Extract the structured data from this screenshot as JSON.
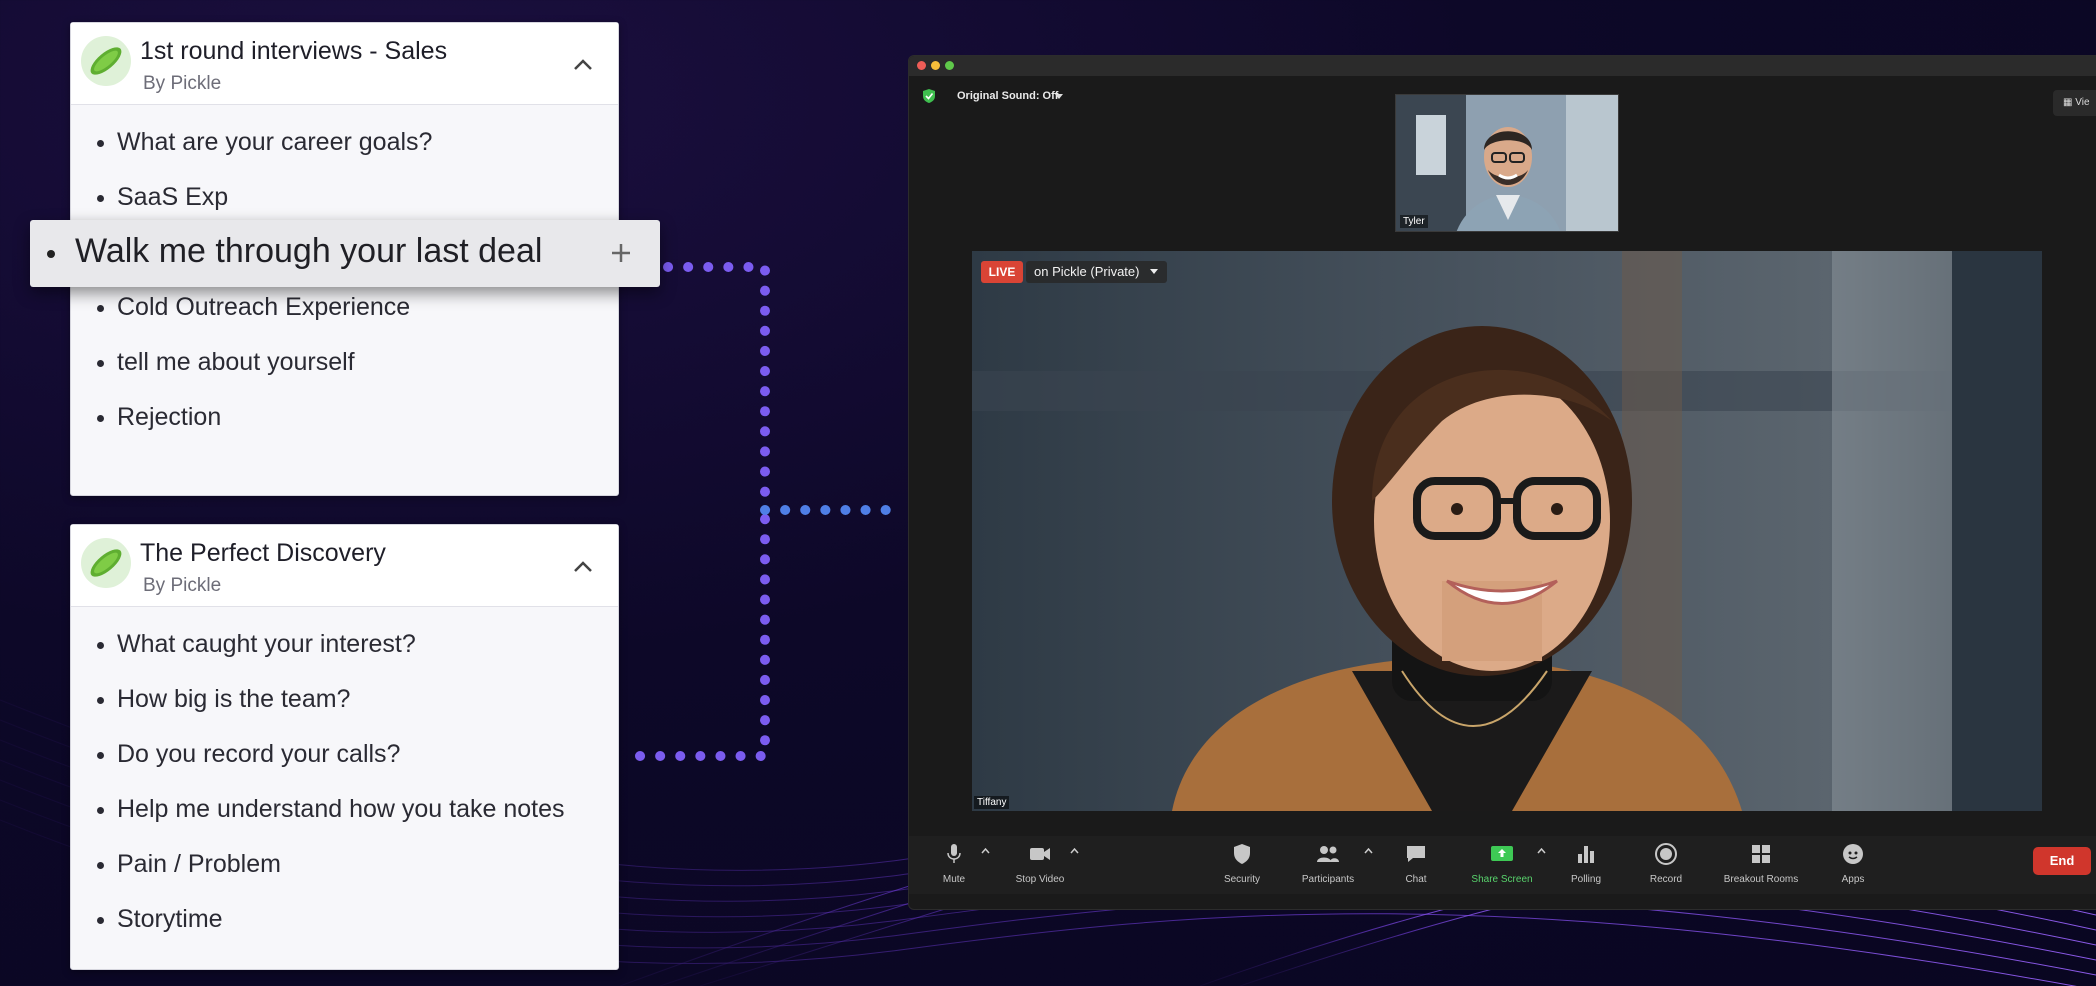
{
  "cards": [
    {
      "title": "1st round interviews - Sales",
      "subtitle": "By Pickle",
      "items": [
        "What are your career goals?",
        "SaaS Exp",
        "Cold Outreach Experience",
        "tell me about yourself",
        "Rejection"
      ]
    },
    {
      "title": "The Perfect Discovery",
      "subtitle": "By Pickle",
      "items": [
        "What caught your interest?",
        "How big is the team?",
        "Do you record your calls?",
        "Help me understand how you take notes",
        "Pain / Problem",
        "Storytime"
      ]
    }
  ],
  "drag_item": {
    "text": "Walk me through your last deal",
    "icon": "plus-icon"
  },
  "zoom": {
    "original_sound": "Original Sound: Off",
    "view_label": "Vie",
    "thumbnail_name": "Tyler",
    "live": {
      "badge": "LIVE",
      "destination": "on Pickle (Private)"
    },
    "video_name": "Tiffany",
    "toolbar": {
      "mute": "Mute",
      "stop_video": "Stop Video",
      "security": "Security",
      "participants": "Participants",
      "chat": "Chat",
      "share_screen": "Share Screen",
      "polling": "Polling",
      "record": "Record",
      "breakout_rooms": "Breakout Rooms",
      "apps": "Apps",
      "end": "End"
    }
  },
  "colors": {
    "background": "#0d0828",
    "connector_purple": "#7b5cf0",
    "connector_blue": "#4f7fe6",
    "live_red": "#d94435",
    "share_green": "#58d36c",
    "end_red": "#d0362c"
  }
}
